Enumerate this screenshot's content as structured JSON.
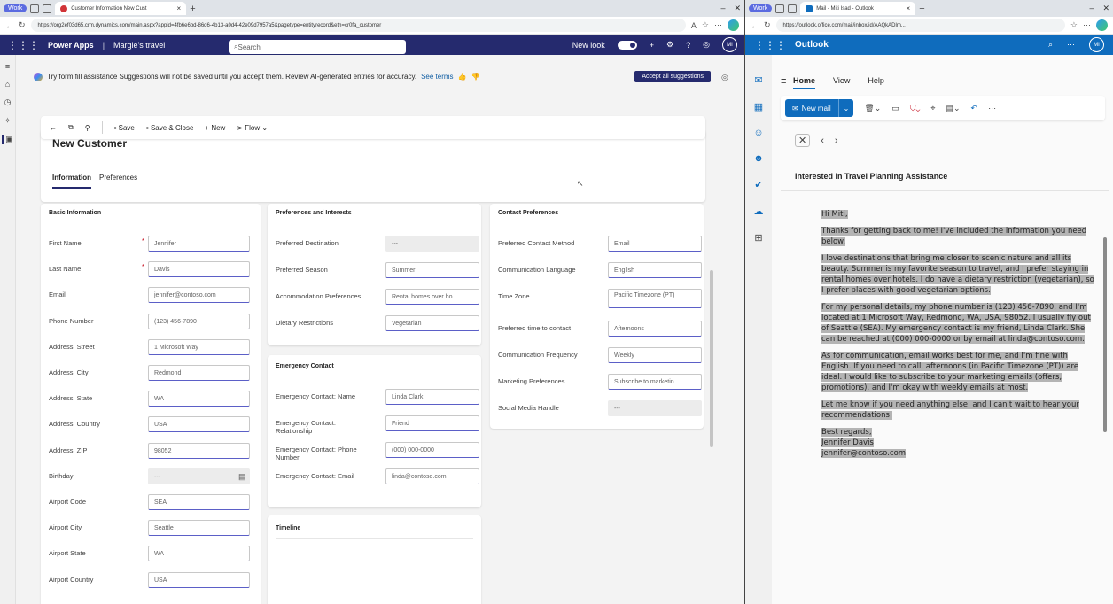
{
  "left_browser": {
    "profile": "Work",
    "tab_title": "Customer Information New Cust",
    "url": "https://org2ef03d65.crm.dynamics.com/main.aspx?appid=4fb6e6bd-86d6-4b13-a0d4-42e09d7957a5&pagetype=entityrecord&etn=cr0fa_customer"
  },
  "powerapps": {
    "product": "Power Apps",
    "app_name": "Margie's travel",
    "search_placeholder": "Search",
    "new_look": "New look",
    "avatar": "MI"
  },
  "banner": {
    "text": "Try form fill assistance Suggestions will not be saved until you accept them. Review AI-generated entries for accuracy.",
    "link": "See terms",
    "accept": "Accept all suggestions"
  },
  "commands": {
    "save": "Save",
    "save_close": "Save & Close",
    "new": "New",
    "flow": "Flow"
  },
  "form": {
    "title": "New Customer",
    "tabs": [
      "Information",
      "Preferences"
    ]
  },
  "basic_info": {
    "title": "Basic Information",
    "fields": [
      {
        "label": "First Name",
        "value": "Jennifer",
        "required": "*"
      },
      {
        "label": "Last Name",
        "value": "Davis",
        "required": "*"
      },
      {
        "label": "Email",
        "value": "jennifer@contoso.com",
        "required": ""
      },
      {
        "label": "Phone Number",
        "value": "(123) 456-7890",
        "required": ""
      },
      {
        "label": "Address: Street",
        "value": "1 Microsoft Way",
        "required": ""
      },
      {
        "label": "Address: City",
        "value": "Redmond",
        "required": ""
      },
      {
        "label": "Address: State",
        "value": "WA",
        "required": ""
      },
      {
        "label": "Address: Country",
        "value": "USA",
        "required": ""
      },
      {
        "label": "Address: ZIP",
        "value": "98052",
        "required": ""
      },
      {
        "label": "Birthday",
        "value": "---",
        "required": ""
      },
      {
        "label": "Airport Code",
        "value": "SEA",
        "required": ""
      },
      {
        "label": "Airport City",
        "value": "Seattle",
        "required": ""
      },
      {
        "label": "Airport State",
        "value": "WA",
        "required": ""
      },
      {
        "label": "Airport Country",
        "value": "USA",
        "required": ""
      }
    ]
  },
  "prefs": {
    "title": "Preferences and Interests",
    "fields": [
      {
        "label": "Preferred Destination",
        "value": "---"
      },
      {
        "label": "Preferred Season",
        "value": "Summer"
      },
      {
        "label": "Accommodation Preferences",
        "value": "Rental homes over ho..."
      },
      {
        "label": "Dietary Restrictions",
        "value": "Vegetarian"
      }
    ]
  },
  "emergency": {
    "title": "Emergency Contact",
    "fields": [
      {
        "label": "Emergency Contact: Name",
        "value": "Linda Clark"
      },
      {
        "label": "Emergency Contact: Relationship",
        "value": "Friend"
      },
      {
        "label": "Emergency Contact: Phone Number",
        "value": "(000) 000-0000"
      },
      {
        "label": "Emergency Contact: Email",
        "value": "linda@contoso.com"
      }
    ]
  },
  "timeline": {
    "title": "Timeline"
  },
  "contact_prefs": {
    "title": "Contact Preferences",
    "fields": [
      {
        "label": "Preferred Contact Method",
        "value": "Email"
      },
      {
        "label": "Communication Language",
        "value": "English"
      },
      {
        "label": "Time Zone",
        "value": "Pacific Timezone (PT)"
      },
      {
        "label": "Preferred time to contact",
        "value": "Afternoons"
      },
      {
        "label": "Communication Frequency",
        "value": "Weekly"
      },
      {
        "label": "Marketing Preferences",
        "value": "Subscribe to marketin..."
      },
      {
        "label": "Social Media Handle",
        "value": "---"
      }
    ]
  },
  "right_browser": {
    "profile": "Work",
    "tab_title": "Mail - Miti Isad - Outlook",
    "url": "https://outlook.office.com/mail/inbox/id/AAQkADlm..."
  },
  "outlook": {
    "app": "Outlook",
    "avatar": "MI",
    "ribbon_tabs": [
      "Home",
      "View",
      "Help"
    ],
    "new_mail": "New mail",
    "subject": "Interested in Travel Planning Assistance",
    "greeting": "Hi Miti,",
    "paragraphs": [
      "Thanks for getting back to me! I've included the information you need below.",
      "I love destinations that bring me closer to scenic nature and all its beauty. Summer is my favorite season to travel, and I prefer staying in rental homes over hotels. I do have a dietary restriction (vegetarian), so I prefer places with good vegetarian options.",
      "For my personal details, my phone number is (123) 456-7890, and I'm located at 1 Microsoft Way, Redmond, WA, USA, 98052. I usually fly out of Seattle (SEA). My emergency contact is my friend, Linda Clark. She can be reached at (000) 000-0000 or by email at linda@contoso.com.",
      "As for communication, email works best for me, and I'm fine with English. If you need to call, afternoons (in Pacific Timezone (PT)) are ideal. I would like to subscribe to your marketing emails (offers, promotions), and I'm okay with weekly emails at most.",
      "Let me know if you need anything else, and I can't wait to hear your recommendations!"
    ],
    "closing": "Best regards,",
    "sig_name": "Jennifer Davis",
    "sig_email": "jennifer@contoso.com"
  }
}
